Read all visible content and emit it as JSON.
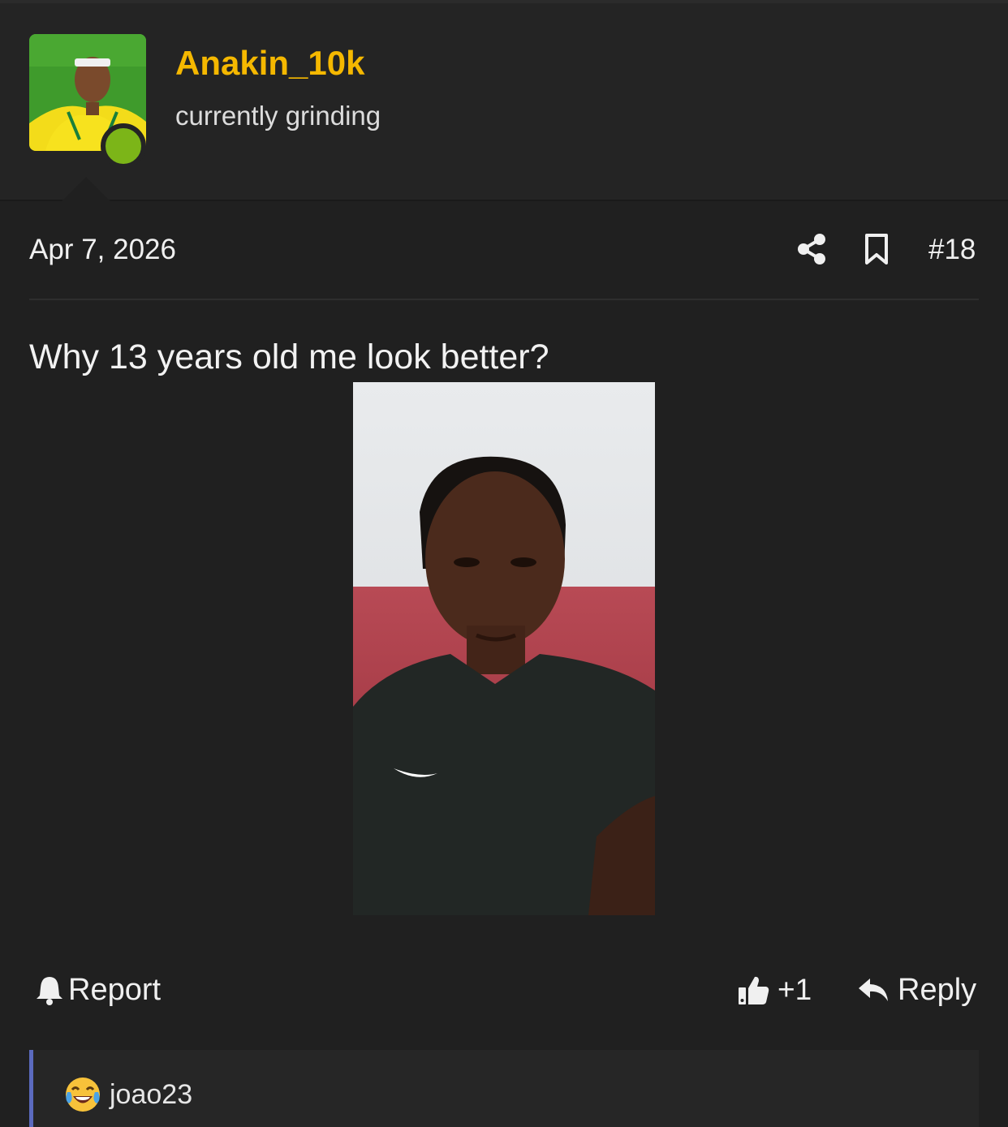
{
  "user": {
    "name": "Anakin_10k",
    "title": "currently grinding",
    "online": true,
    "name_color": "#f5b800",
    "online_color": "#7cb518"
  },
  "post": {
    "date": "Apr 7, 2026",
    "number": "#18",
    "text": "Why 13 years old me look better?"
  },
  "actions": {
    "report_label": "Report",
    "like_count": "+1",
    "reply_label": "Reply"
  },
  "reactions": [
    {
      "emoji": "face-with-tears-of-joy",
      "user": "joao23"
    }
  ],
  "icons": {
    "share": "share-icon",
    "bookmark": "bookmark-icon",
    "report": "bell-icon",
    "like": "thumbs-up-icon",
    "reply": "reply-arrow-icon"
  }
}
